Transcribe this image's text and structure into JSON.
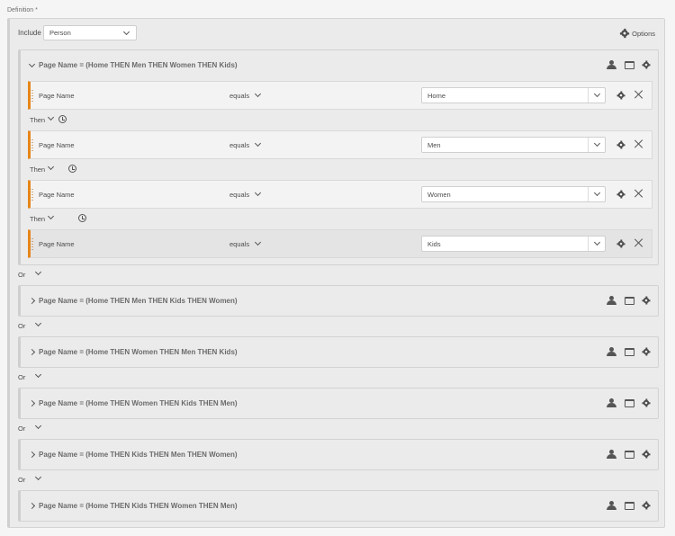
{
  "definition_label": "Definition",
  "required_mark": "*",
  "include": {
    "label": "Include",
    "selected": "Person"
  },
  "options_label": "Options",
  "then_label": "Then",
  "or_label": "Or",
  "containers": [
    {
      "title": "Page Name = (Home THEN Men THEN Women THEN Kids)",
      "expanded": true,
      "rules": [
        {
          "dimension": "Page Name",
          "operator": "equals",
          "value": "Home"
        },
        {
          "dimension": "Page Name",
          "operator": "equals",
          "value": "Men"
        },
        {
          "dimension": "Page Name",
          "operator": "equals",
          "value": "Women"
        },
        {
          "dimension": "Page Name",
          "operator": "equals",
          "value": "Kids"
        }
      ]
    },
    {
      "title": "Page Name = (Home THEN Men THEN Kids THEN Women)",
      "expanded": false
    },
    {
      "title": "Page Name = (Home THEN Women THEN Men THEN Kids)",
      "expanded": false
    },
    {
      "title": "Page Name = (Home THEN Women THEN Kids THEN Men)",
      "expanded": false
    },
    {
      "title": "Page Name = (Home THEN Kids THEN Men THEN Women)",
      "expanded": false
    },
    {
      "title": "Page Name = (Home THEN Kids THEN Women THEN Men)",
      "expanded": false
    }
  ],
  "colors": {
    "accent": "#e68619",
    "background": "#ebebeb"
  },
  "icons": [
    "gear-icon",
    "person-icon",
    "window-icon",
    "close-icon",
    "clock-icon",
    "chevron-down-icon",
    "chevron-right-icon"
  ]
}
